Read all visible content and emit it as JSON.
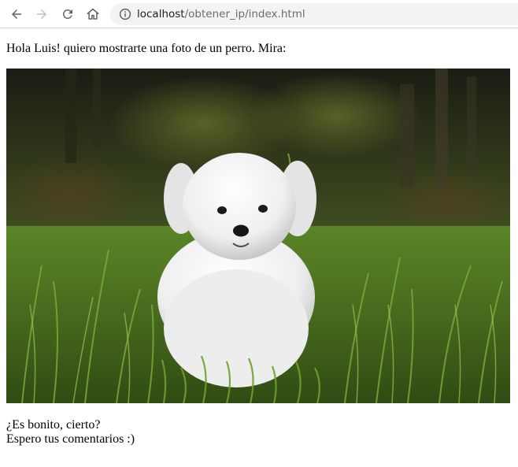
{
  "browser": {
    "url_host": "localhost",
    "url_path": "/obtener_ip/index.html",
    "icons": {
      "back": "back-arrow-icon",
      "forward": "forward-arrow-icon",
      "reload": "reload-icon",
      "home": "home-icon",
      "site_info": "info-icon"
    }
  },
  "content": {
    "intro": "Hola Luis! quiero mostrarte una foto de un perro. Mira:",
    "question": "¿Es bonito, cierto?",
    "closing": "Espero tus comentarios :)"
  },
  "colors": {
    "toolbar_bg": "#ffffff",
    "omnibox_bg": "#f1f3f4",
    "page_text": "#000000"
  }
}
